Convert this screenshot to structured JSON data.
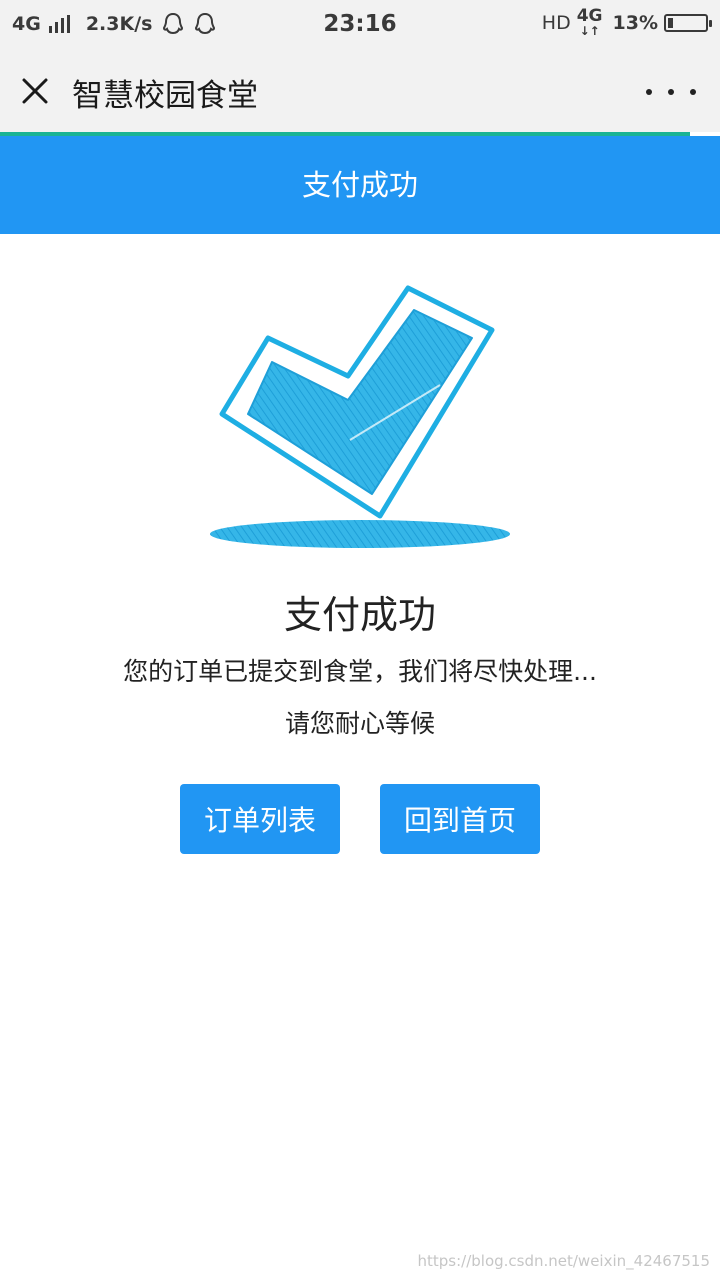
{
  "status_bar": {
    "network": "4G",
    "speed": "2.3K/s",
    "time": "23:16",
    "hd": "HD",
    "network2": "4G",
    "battery": "13%",
    "battery_level": 0.13
  },
  "app_header": {
    "title": "智慧校园食堂"
  },
  "nav": {
    "title": "支付成功"
  },
  "result": {
    "title": "支付成功",
    "message": "您的订单已提交到食堂，我们将尽快处理...",
    "wait": "请您耐心等候"
  },
  "buttons": {
    "orders": "订单列表",
    "home": "回到首页"
  },
  "watermark": "https://blog.csdn.net/weixin_42467515",
  "colors": {
    "primary": "#2196f3",
    "check": "#1eaee3",
    "progress": "#1ab394"
  }
}
